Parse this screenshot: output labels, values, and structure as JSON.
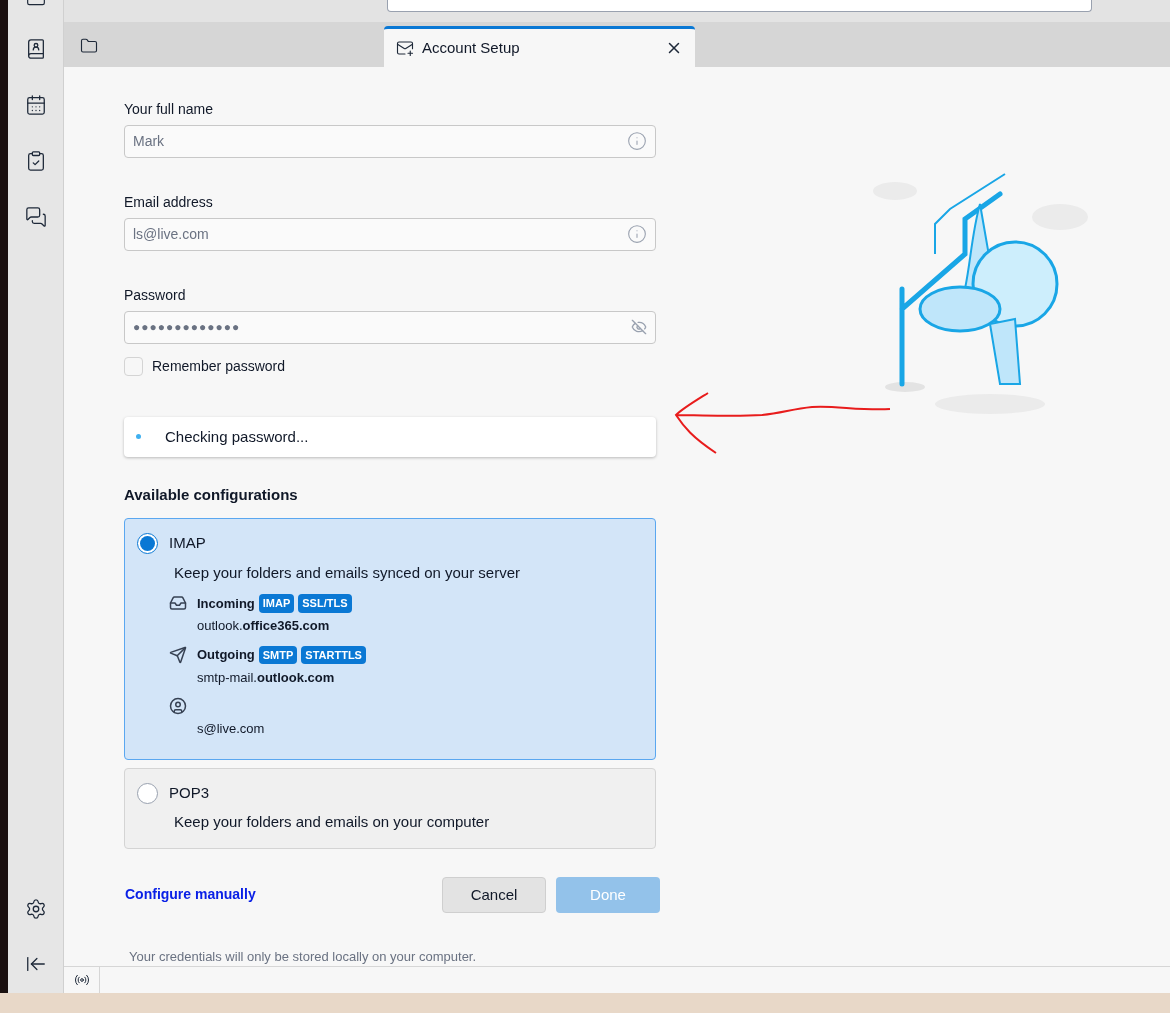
{
  "tab": {
    "title": "Account Setup"
  },
  "fields": [
    {
      "label": "Your full name",
      "value": "Mark",
      "kind": "text"
    },
    {
      "label": "Email address",
      "value": "ls@live.com",
      "kind": "email"
    },
    {
      "label": "Password",
      "value": "●●●●●●●●●●●●●",
      "kind": "password"
    }
  ],
  "remember": {
    "label": "Remember password",
    "checked": false
  },
  "status": {
    "text": "Checking password..."
  },
  "configurations": {
    "title": "Available configurations",
    "items": [
      {
        "name": "IMAP",
        "selected": true,
        "description": "Keep your folders and emails synced on your server",
        "servers": [
          {
            "kind": "incoming",
            "label": "Incoming",
            "tags": [
              "IMAP",
              "SSL/TLS"
            ],
            "host": "outlook.**office365.com**"
          },
          {
            "kind": "outgoing",
            "label": "Outgoing",
            "tags": [
              "SMTP",
              "STARTTLS"
            ],
            "host": "smtp-mail.**outlook.com**"
          },
          {
            "kind": "user",
            "host": "s@live.com"
          }
        ]
      },
      {
        "name": "POP3",
        "selected": false,
        "description": "Keep your folders and emails on your computer"
      }
    ]
  },
  "link": "Configure manually",
  "buttons": [
    {
      "label": "Cancel",
      "kind": "secondary",
      "disabled": false
    },
    {
      "label": "Done",
      "kind": "primary",
      "disabled": true
    }
  ],
  "footer": "Your credentials will only be stored locally on your computer."
}
